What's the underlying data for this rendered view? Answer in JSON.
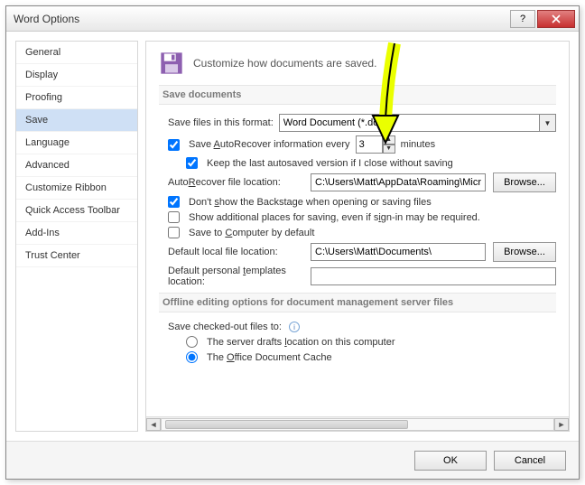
{
  "window": {
    "title": "Word Options"
  },
  "sidebar": {
    "items": [
      {
        "label": "General"
      },
      {
        "label": "Display"
      },
      {
        "label": "Proofing"
      },
      {
        "label": "Save",
        "selected": true
      },
      {
        "label": "Language"
      },
      {
        "label": "Advanced"
      },
      {
        "label": "Customize Ribbon"
      },
      {
        "label": "Quick Access Toolbar"
      },
      {
        "label": "Add-Ins"
      },
      {
        "label": "Trust Center"
      }
    ]
  },
  "header": {
    "text": "Customize how documents are saved."
  },
  "group1": {
    "title": "Save documents",
    "save_format_label": "Save files in this format:",
    "save_format_value": "Word Document (*.docx)",
    "autorecover_label_pre": "Save AutoRecover information every",
    "autorecover_value": "3",
    "autorecover_label_post": "minutes",
    "keep_last_label": "Keep the last autosaved version if I close without saving",
    "autorecover_loc_label": "AutoRecover file location:",
    "autorecover_loc_value": "C:\\Users\\Matt\\AppData\\Roaming\\Micro",
    "browse1": "Browse...",
    "backstage_label": "Don't show the Backstage when opening or saving files",
    "additional_label": "Show additional places for saving, even if sign-in may be required.",
    "save_computer_label": "Save to Computer by default",
    "default_loc_label": "Default local file location:",
    "default_loc_value": "C:\\Users\\Matt\\Documents\\",
    "browse2": "Browse...",
    "templates_label": "Default personal templates location:",
    "templates_value": ""
  },
  "group2": {
    "title": "Offline editing options for document management server files",
    "checked_out_label": "Save checked-out files to:",
    "radio1": "The server drafts location on this computer",
    "radio2": "The Office Document Cache"
  },
  "footer": {
    "ok": "OK",
    "cancel": "Cancel"
  },
  "checks": {
    "autorecover": true,
    "keep_last": true,
    "backstage": true,
    "additional": false,
    "save_computer": false,
    "radio_sel": "cache"
  }
}
